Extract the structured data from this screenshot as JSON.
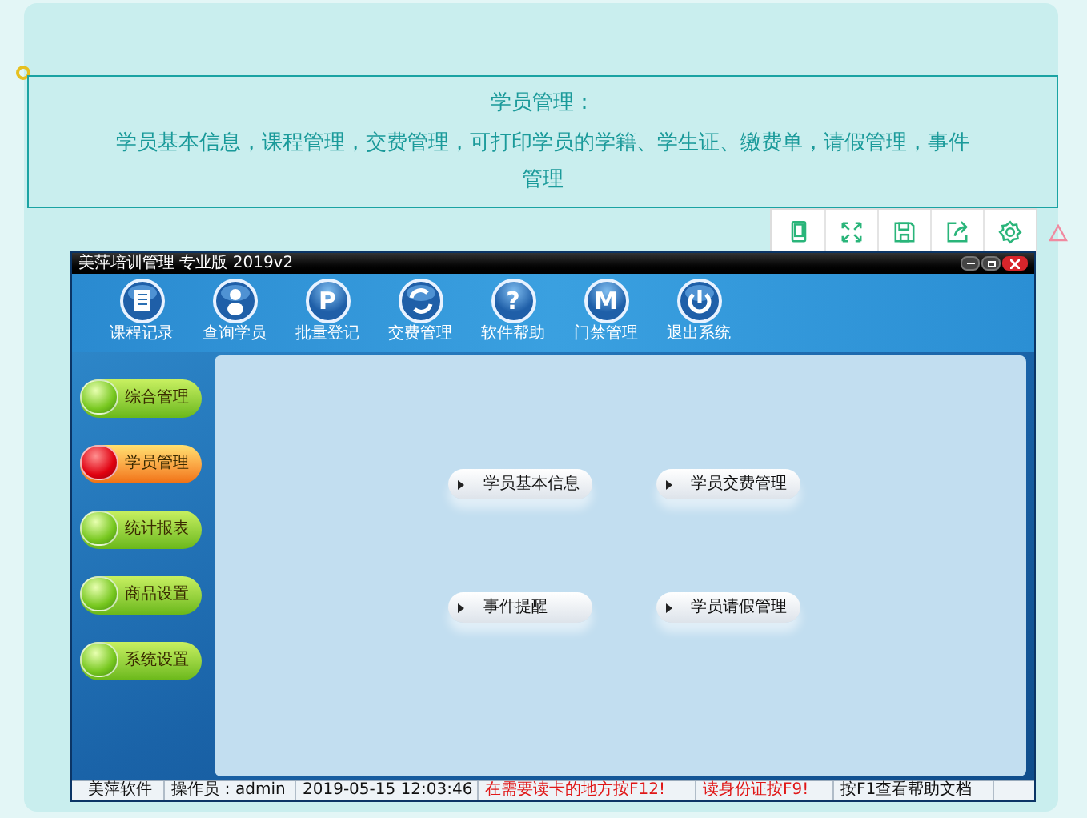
{
  "header": {
    "title": "学员管理：",
    "description": "学员基本信息，课程管理，交费管理，可打印学员的学籍、学生证、缴费单，请假管理，事件管理"
  },
  "app": {
    "title": "美萍培训管理 专业版 2019v2",
    "toolbar": [
      {
        "label": "课程记录",
        "kind": "document"
      },
      {
        "label": "查询学员",
        "kind": "person"
      },
      {
        "label": "批量登记",
        "kind": "letter",
        "glyph": "P"
      },
      {
        "label": "交费管理",
        "kind": "refresh"
      },
      {
        "label": "软件帮助",
        "kind": "letter",
        "glyph": "?"
      },
      {
        "label": "门禁管理",
        "kind": "letter",
        "glyph": "M"
      },
      {
        "label": "退出系统",
        "kind": "power"
      }
    ],
    "sidebar": [
      {
        "label": "综合管理",
        "selected": false
      },
      {
        "label": "学员管理",
        "selected": true
      },
      {
        "label": "统计报表",
        "selected": false
      },
      {
        "label": "商品设置",
        "selected": false
      },
      {
        "label": "系统设置",
        "selected": false
      }
    ],
    "actions": [
      "学员基本信息",
      "学员交费管理",
      "事件提醒",
      "学员请假管理"
    ],
    "status_bar": [
      {
        "text": "美萍软件",
        "kind": "normal"
      },
      {
        "text": "操作员：admin",
        "kind": "normal"
      },
      {
        "text": "2019-05-15 12:03:46",
        "kind": "normal"
      },
      {
        "text": "在需要读卡的地方按F12!",
        "kind": "alert"
      },
      {
        "text": "读身份证按F9!",
        "kind": "alert"
      },
      {
        "text": "按F1查看帮助文档",
        "kind": "normal"
      }
    ]
  }
}
